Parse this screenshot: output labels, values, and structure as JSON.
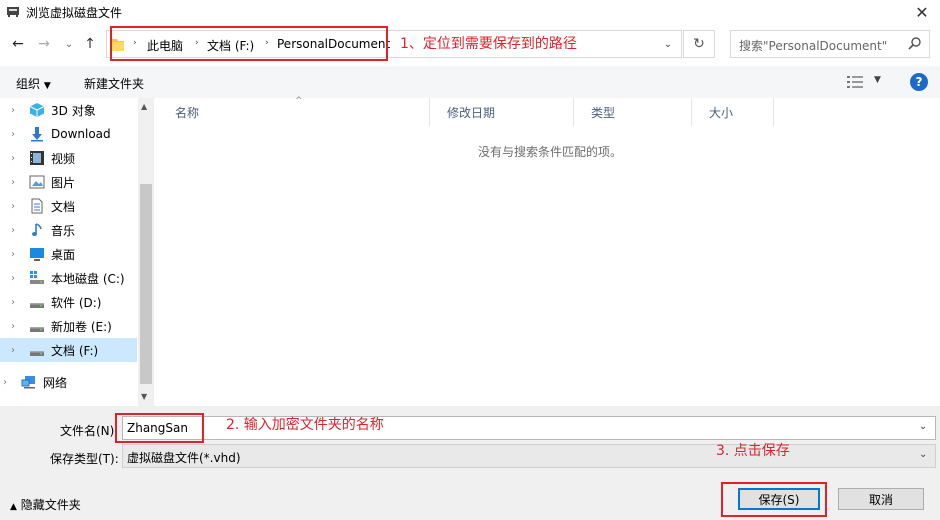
{
  "window": {
    "title": "浏览虚拟磁盘文件"
  },
  "nav": {
    "breadcrumbs": [
      "此电脑",
      "文档 (F:)",
      "PersonalDocument"
    ],
    "search_placeholder": "搜索\"PersonalDocument\""
  },
  "toolbar": {
    "organize": "组织",
    "new_folder": "新建文件夹"
  },
  "sidebar": {
    "items": [
      {
        "label": "3D 对象",
        "icon": "3d-objects-icon"
      },
      {
        "label": "Download",
        "icon": "download-icon"
      },
      {
        "label": "视频",
        "icon": "video-icon"
      },
      {
        "label": "图片",
        "icon": "pictures-icon"
      },
      {
        "label": "文档",
        "icon": "documents-icon"
      },
      {
        "label": "音乐",
        "icon": "music-icon"
      },
      {
        "label": "桌面",
        "icon": "desktop-icon"
      },
      {
        "label": "本地磁盘 (C:)",
        "icon": "system-drive-icon"
      },
      {
        "label": "软件 (D:)",
        "icon": "drive-icon"
      },
      {
        "label": "新加卷 (E:)",
        "icon": "drive-icon"
      },
      {
        "label": "文档 (F:)",
        "icon": "drive-icon",
        "selected": true
      },
      {
        "label": "网络",
        "icon": "network-icon"
      }
    ]
  },
  "filelist": {
    "columns": [
      "名称",
      "修改日期",
      "类型",
      "大小"
    ],
    "empty_message": "没有与搜索条件匹配的项。"
  },
  "form": {
    "filename_label": "文件名(N):",
    "filename_value": "ZhangSan",
    "filetype_label": "保存类型(T):",
    "filetype_value": "虚拟磁盘文件(*.vhd)",
    "hide_folders": "隐藏文件夹",
    "save": "保存(S)",
    "cancel": "取消"
  },
  "annotations": {
    "step1": "1、定位到需要保存到的路径",
    "step2": "2.  输入加密文件夹的名称",
    "step3": "3.  点击保存"
  },
  "colors": {
    "annotation_red": "#e0232b",
    "selection": "#cce8ff",
    "accent": "#0078d7"
  }
}
